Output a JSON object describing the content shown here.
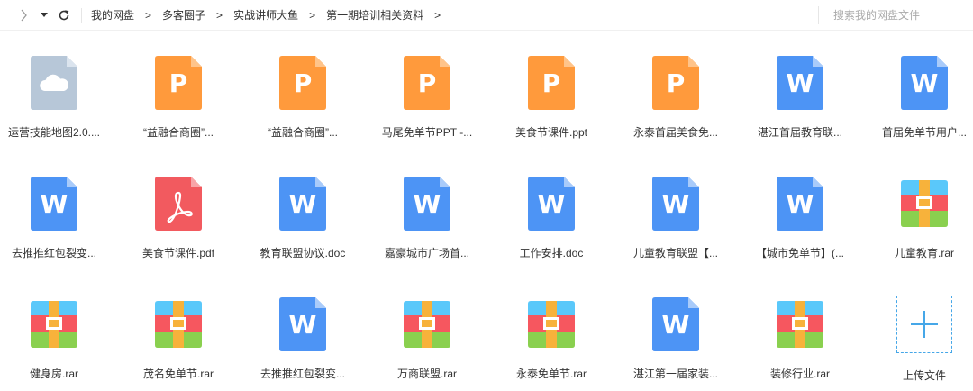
{
  "toolbar": {
    "back_icon": "chevron-left-icon",
    "dropdown_icon": "caret-down-icon",
    "refresh_icon": "refresh-icon"
  },
  "breadcrumb": {
    "items": [
      "我的网盘",
      "多客圈子",
      "实战讲师大鱼",
      "第一期培训相关资料"
    ],
    "separator": ">"
  },
  "search": {
    "placeholder": "搜索我的网盘文件"
  },
  "files": [
    {
      "name": "运营技能地图2.0....",
      "type": "cloud"
    },
    {
      "name": "“益融合商圈”...",
      "type": "ppt"
    },
    {
      "name": "“益融合商圈”...",
      "type": "ppt"
    },
    {
      "name": "马尾免单节PPT -...",
      "type": "ppt"
    },
    {
      "name": "美食节课件.ppt",
      "type": "ppt"
    },
    {
      "name": "永泰首届美食免...",
      "type": "ppt"
    },
    {
      "name": "湛江首届教育联...",
      "type": "doc"
    },
    {
      "name": "首届免单节用户...",
      "type": "doc"
    },
    {
      "name": "去推推红包裂变...",
      "type": "doc"
    },
    {
      "name": "美食节课件.pdf",
      "type": "pdf"
    },
    {
      "name": "教育联盟协议.doc",
      "type": "doc"
    },
    {
      "name": "嘉豪城市广场首...",
      "type": "doc"
    },
    {
      "name": "工作安排.doc",
      "type": "doc"
    },
    {
      "name": "儿童教育联盟【...",
      "type": "doc"
    },
    {
      "name": "【城市免单节】(...",
      "type": "doc"
    },
    {
      "name": "儿童教育.rar",
      "type": "rar"
    },
    {
      "name": "健身房.rar",
      "type": "rar"
    },
    {
      "name": "茂名免单节.rar",
      "type": "rar"
    },
    {
      "name": "去推推红包裂变...",
      "type": "doc"
    },
    {
      "name": "万商联盟.rar",
      "type": "rar"
    },
    {
      "name": "永泰免单节.rar",
      "type": "rar"
    },
    {
      "name": "湛江第一届家装...",
      "type": "doc"
    },
    {
      "name": "装修行业.rar",
      "type": "rar"
    }
  ],
  "upload": {
    "label": "上传文件",
    "icon": "plus-icon"
  },
  "colors": {
    "ppt": "#ff9a3c",
    "ppt_fold": "#ffc48a",
    "doc": "#4d94f5",
    "doc_fold": "#a9cbfa",
    "pdf": "#f25a5f",
    "pdf_fold": "#f8a5a8",
    "cloud": "#b7c7d8",
    "cloud_fold": "#dbe4ee",
    "accent": "#46a7e8"
  }
}
